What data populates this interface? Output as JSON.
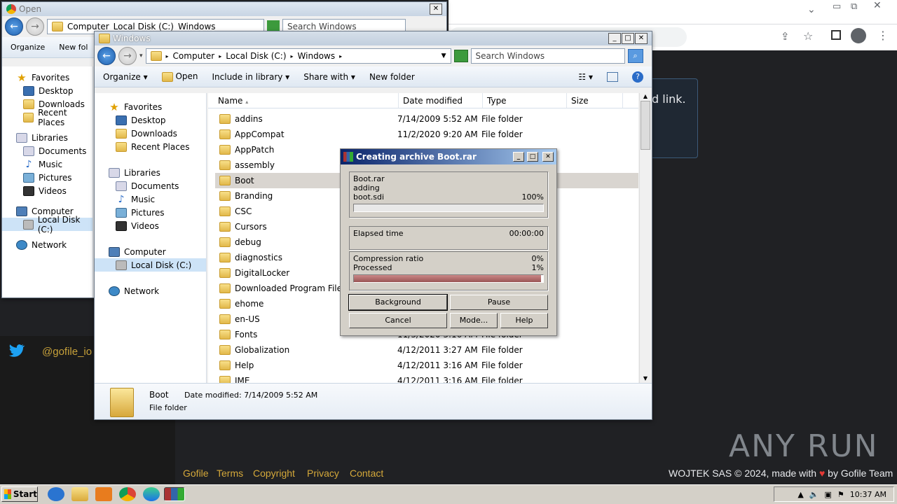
{
  "background": {
    "card_text": "d link.",
    "twitter_handle": "@gofile_io",
    "footer_links": [
      "Gofile",
      "Terms",
      "Copyright",
      "Privacy",
      "Contact"
    ],
    "footer_right": "WOJTEK SAS © 2024, made with",
    "footer_right_tail": "by Gofile Team",
    "watermark": "ANY RUN"
  },
  "open_dialog": {
    "title": "Open",
    "address": [
      "Computer",
      "Local Disk (C:)",
      "Windows"
    ],
    "search_placeholder": "Search Windows",
    "cmd": {
      "organize": "Organize",
      "new_folder": "New fol"
    },
    "nav": [
      {
        "label": "Favorites",
        "icon": "star-icon"
      },
      {
        "label": "Desktop",
        "icon": "desktop-icon"
      },
      {
        "label": "Downloads",
        "icon": "downloads-icon"
      },
      {
        "label": "Recent Places",
        "icon": "recent-places-icon"
      },
      {
        "label": "Libraries",
        "icon": "libraries-icon"
      },
      {
        "label": "Documents",
        "icon": "documents-icon"
      },
      {
        "label": "Music",
        "icon": "music-icon"
      },
      {
        "label": "Pictures",
        "icon": "pictures-icon"
      },
      {
        "label": "Videos",
        "icon": "videos-icon"
      },
      {
        "label": "Computer",
        "icon": "computer-icon"
      },
      {
        "label": "Local Disk (C:)",
        "icon": "disk-icon"
      },
      {
        "label": "Network",
        "icon": "network-icon"
      }
    ]
  },
  "explorer": {
    "title": "Windows",
    "address": [
      "Computer",
      "Local Disk (C:)",
      "Windows"
    ],
    "search_placeholder": "Search Windows",
    "cmd": {
      "organize": "Organize",
      "open": "Open",
      "include": "Include in library",
      "share": "Share with",
      "new_folder": "New folder"
    },
    "nav": [
      {
        "label": "Favorites"
      },
      {
        "label": "Desktop"
      },
      {
        "label": "Downloads"
      },
      {
        "label": "Recent Places"
      },
      {
        "label": "Libraries"
      },
      {
        "label": "Documents"
      },
      {
        "label": "Music"
      },
      {
        "label": "Pictures"
      },
      {
        "label": "Videos"
      },
      {
        "label": "Computer"
      },
      {
        "label": "Local Disk (C:)"
      },
      {
        "label": "Network"
      }
    ],
    "columns": {
      "name": "Name",
      "date": "Date modified",
      "type": "Type",
      "size": "Size"
    },
    "files": [
      {
        "name": "addins",
        "date": "7/14/2009 5:52 AM",
        "type": "File folder"
      },
      {
        "name": "AppCompat",
        "date": "11/2/2020 9:20 AM",
        "type": "File folder"
      },
      {
        "name": "AppPatch",
        "date": "",
        "type": ""
      },
      {
        "name": "assembly",
        "date": "",
        "type": ""
      },
      {
        "name": "Boot",
        "date": "",
        "type": ""
      },
      {
        "name": "Branding",
        "date": "",
        "type": ""
      },
      {
        "name": "CSC",
        "date": "",
        "type": ""
      },
      {
        "name": "Cursors",
        "date": "",
        "type": ""
      },
      {
        "name": "debug",
        "date": "",
        "type": ""
      },
      {
        "name": "diagnostics",
        "date": "",
        "type": ""
      },
      {
        "name": "DigitalLocker",
        "date": "",
        "type": ""
      },
      {
        "name": "Downloaded Program Files",
        "date": "",
        "type": ""
      },
      {
        "name": "ehome",
        "date": "",
        "type": ""
      },
      {
        "name": "en-US",
        "date": "",
        "type": ""
      },
      {
        "name": "Fonts",
        "date": "11/3/2020 3:16 AM",
        "type": "File folder"
      },
      {
        "name": "Globalization",
        "date": "4/12/2011 3:27 AM",
        "type": "File folder"
      },
      {
        "name": "Help",
        "date": "4/12/2011 3:16 AM",
        "type": "File folder"
      },
      {
        "name": "IME",
        "date": "4/12/2011 3:16 AM",
        "type": "File folder"
      }
    ],
    "details": {
      "name": "Boot",
      "date_label": "Date modified: 7/14/2009 5:52 AM",
      "type": "File folder"
    }
  },
  "rar": {
    "title": "Creating archive Boot.rar",
    "archive": "Boot.rar",
    "action": "adding",
    "file": "boot.sdi",
    "file_pct": "100%",
    "file_progress": 1.0,
    "elapsed_label": "Elapsed time",
    "elapsed": "00:00:00",
    "ratio_label": "Compression ratio",
    "ratio": "0%",
    "processed_label": "Processed",
    "processed": "1%",
    "processed_progress": 0.99,
    "buttons": {
      "background": "Background",
      "pause": "Pause",
      "cancel": "Cancel",
      "mode": "Mode...",
      "help": "Help"
    }
  },
  "taskbar": {
    "start": "Start",
    "time": "10:37 AM"
  },
  "colors": {
    "accent": "#1e5fae",
    "rar_title": "#0a246a",
    "footer_link": "#d4a83a",
    "heart": "#e53935"
  }
}
